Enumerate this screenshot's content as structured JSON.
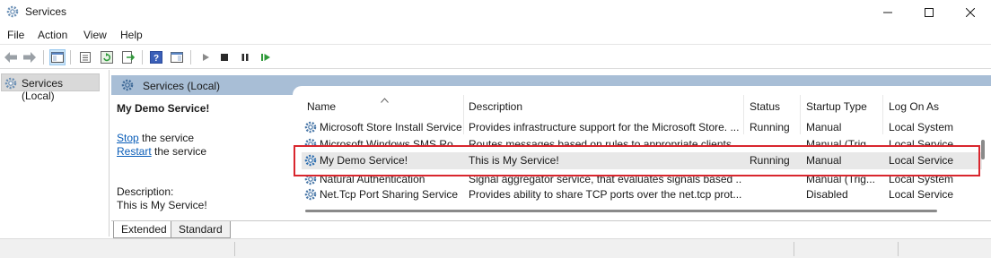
{
  "window": {
    "title": "Services",
    "icon": "gear-icon"
  },
  "menu": [
    "File",
    "Action",
    "View",
    "Help"
  ],
  "toolbar": {
    "buttons": [
      "back-icon",
      "forward-icon",
      "show-hide-console-tree-icon",
      "properties-icon",
      "refresh-icon",
      "export-list-icon",
      "help-icon",
      "action-pane-icon",
      "start-icon",
      "stop-icon",
      "pause-icon",
      "resume-icon"
    ]
  },
  "tree": {
    "selected_label": "Services (Local)"
  },
  "pane": {
    "header_title": "Services (Local)"
  },
  "detail": {
    "service_name": "My Demo Service!",
    "stop_link": "Stop",
    "stop_suffix": " the service",
    "restart_link": "Restart",
    "restart_suffix": " the service",
    "description_label": "Description:",
    "description_value": "This is My Service!"
  },
  "columns": [
    "Name",
    "Description",
    "Status",
    "Startup Type",
    "Log On As"
  ],
  "rows": [
    {
      "name": "Microsoft Store Install Service",
      "description": "Provides infrastructure support for the Microsoft Store. ...",
      "status": "Running",
      "startup": "Manual",
      "logon": "Local System"
    },
    {
      "name": "Microsoft Windows SMS Ro...",
      "description": "Routes messages based on rules to appropriate clients.",
      "status": "",
      "startup": "Manual (Trig...",
      "logon": "Local Service"
    },
    {
      "name": "My Demo Service!",
      "description": "This is My Service!",
      "status": "Running",
      "startup": "Manual",
      "logon": "Local Service"
    },
    {
      "name": "Natural Authentication",
      "description": "Signal aggregator service, that evaluates signals based ...",
      "status": "",
      "startup": "Manual (Trig...",
      "logon": "Local System"
    },
    {
      "name": "Net.Tcp Port Sharing Service",
      "description": "Provides ability to share TCP ports over the net.tcp prot...",
      "status": "",
      "startup": "Disabled",
      "logon": "Local Service"
    }
  ],
  "tabs": [
    "Extended",
    "Standard"
  ],
  "colors": {
    "pane_header": "#a8bed6",
    "selection_row": "#e8e8e8",
    "highlight_box": "#d9262e",
    "link": "#0a5db8"
  }
}
